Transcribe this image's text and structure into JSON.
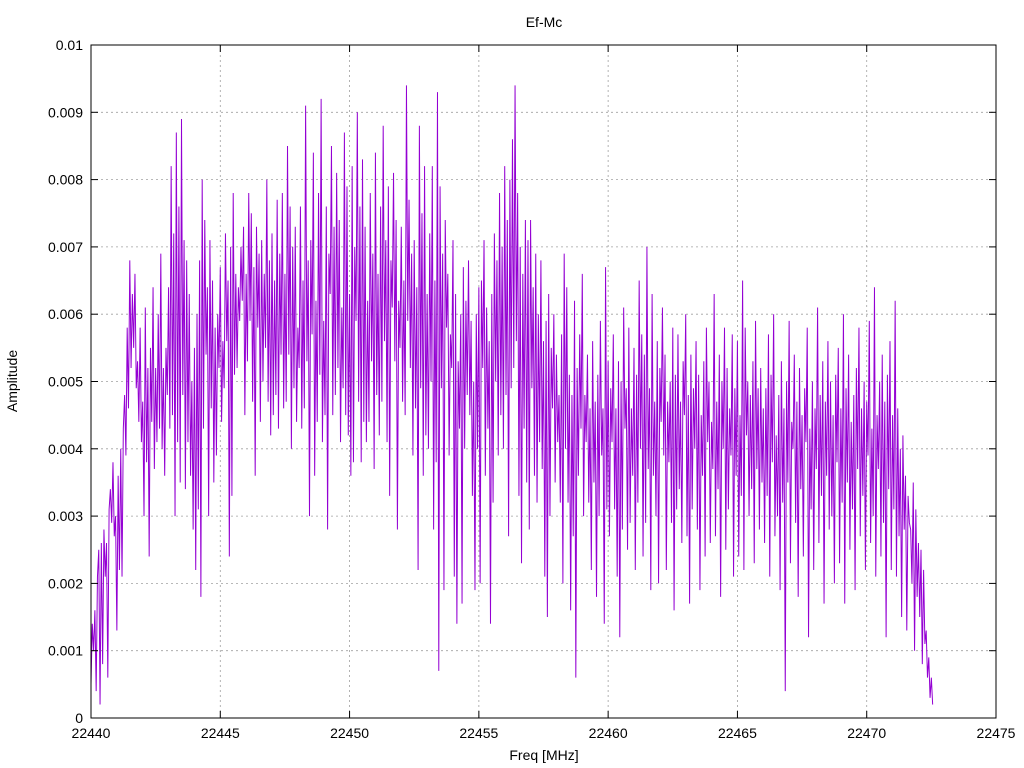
{
  "chart_data": {
    "type": "line",
    "title": "Ef-Mc",
    "xlabel": "Freq [MHz]",
    "ylabel": "Amplitude",
    "xlim": [
      22440,
      22475
    ],
    "ylim": [
      0,
      0.01
    ],
    "x_ticks": [
      "22440",
      "22445",
      "22450",
      "22455",
      "22460",
      "22465",
      "22470",
      "22475"
    ],
    "y_ticks": [
      "0",
      "0.001",
      "0.002",
      "0.003",
      "0.004",
      "0.005",
      "0.006",
      "0.007",
      "0.008",
      "0.009",
      "0.01"
    ],
    "grid": true,
    "legend": "none",
    "series": [
      {
        "color": "#9400d3",
        "x_start": 22440.0,
        "x_step": 0.05,
        "y": [
          0.0005,
          0.0014,
          0.001,
          0.0016,
          0.0004,
          0.0021,
          0.0025,
          0.0002,
          0.0026,
          0.0008,
          0.0028,
          0.0021,
          0.0026,
          0.0006,
          0.0031,
          0.0034,
          0.0029,
          0.0038,
          0.0027,
          0.003,
          0.0013,
          0.0036,
          0.0022,
          0.004,
          0.0021,
          0.0043,
          0.0048,
          0.0039,
          0.0058,
          0.0046,
          0.0068,
          0.0052,
          0.0063,
          0.0055,
          0.0066,
          0.0049,
          0.0053,
          0.0044,
          0.0058,
          0.0041,
          0.0047,
          0.003,
          0.0061,
          0.0038,
          0.0052,
          0.0024,
          0.0055,
          0.0044,
          0.0064,
          0.0037,
          0.0052,
          0.0041,
          0.006,
          0.0043,
          0.0069,
          0.004,
          0.0052,
          0.0036,
          0.0055,
          0.0048,
          0.0064,
          0.0043,
          0.0082,
          0.0045,
          0.0072,
          0.003,
          0.0087,
          0.0041,
          0.0076,
          0.0035,
          0.0089,
          0.0048,
          0.0071,
          0.0034,
          0.0068,
          0.0041,
          0.0063,
          0.0036,
          0.005,
          0.0028,
          0.0055,
          0.0022,
          0.006,
          0.0031,
          0.0068,
          0.0018,
          0.008,
          0.0043,
          0.0074,
          0.0054,
          0.0064,
          0.003,
          0.0071,
          0.0046,
          0.0065,
          0.0035,
          0.0058,
          0.0039,
          0.006,
          0.0052,
          0.0067,
          0.0044,
          0.0056,
          0.0049,
          0.0072,
          0.0056,
          0.0065,
          0.0024,
          0.007,
          0.0033,
          0.0078,
          0.0051,
          0.0066,
          0.0052,
          0.0064,
          0.0059,
          0.007,
          0.0062,
          0.0073,
          0.0045,
          0.0066,
          0.0053,
          0.0078,
          0.0059,
          0.0075,
          0.0047,
          0.0067,
          0.0036,
          0.0073,
          0.0058,
          0.0069,
          0.0044,
          0.0071,
          0.005,
          0.0066,
          0.0055,
          0.008,
          0.0047,
          0.0068,
          0.0042,
          0.0072,
          0.0045,
          0.0065,
          0.0048,
          0.0077,
          0.0043,
          0.0069,
          0.0054,
          0.0078,
          0.0046,
          0.0066,
          0.0047,
          0.0085,
          0.0054,
          0.0076,
          0.004,
          0.007,
          0.0049,
          0.0073,
          0.0044,
          0.0058,
          0.0052,
          0.0076,
          0.0043,
          0.0065,
          0.0046,
          0.0091,
          0.0053,
          0.0068,
          0.003,
          0.0071,
          0.0057,
          0.0084,
          0.0036,
          0.0062,
          0.0044,
          0.0078,
          0.0051,
          0.0092,
          0.0041,
          0.0059,
          0.0045,
          0.0076,
          0.0028,
          0.0069,
          0.0063,
          0.0085,
          0.0045,
          0.0073,
          0.0048,
          0.0081,
          0.0052,
          0.0074,
          0.0041,
          0.0061,
          0.0049,
          0.0087,
          0.0045,
          0.0079,
          0.0042,
          0.0063,
          0.0036,
          0.0082,
          0.0038,
          0.007,
          0.0059,
          0.009,
          0.0047,
          0.0076,
          0.0038,
          0.0083,
          0.0044,
          0.0073,
          0.0041,
          0.0062,
          0.0044,
          0.0078,
          0.0053,
          0.0069,
          0.0037,
          0.0084,
          0.0048,
          0.0066,
          0.0042,
          0.0076,
          0.0047,
          0.0088,
          0.0056,
          0.0071,
          0.0041,
          0.0079,
          0.0033,
          0.0068,
          0.0061,
          0.0081,
          0.0053,
          0.0074,
          0.0028,
          0.0062,
          0.0055,
          0.0073,
          0.0047,
          0.0065,
          0.0045,
          0.0094,
          0.0059,
          0.0077,
          0.0052,
          0.0069,
          0.0039,
          0.0071,
          0.0046,
          0.0064,
          0.0022,
          0.0088,
          0.0049,
          0.0075,
          0.0036,
          0.0082,
          0.0042,
          0.0063,
          0.004,
          0.0072,
          0.005,
          0.0082,
          0.0028,
          0.0065,
          0.0038,
          0.0093,
          0.0007,
          0.0079,
          0.0049,
          0.0069,
          0.0019,
          0.0074,
          0.0058,
          0.0066,
          0.0039,
          0.0057,
          0.0052,
          0.0071,
          0.0021,
          0.0063,
          0.0014,
          0.0053,
          0.0043,
          0.006,
          0.0017,
          0.0067,
          0.004,
          0.0062,
          0.0048,
          0.0068,
          0.0045,
          0.0059,
          0.0033,
          0.005,
          0.0019,
          0.006,
          0.004,
          0.0064,
          0.002,
          0.0065,
          0.0052,
          0.0071,
          0.0036,
          0.0061,
          0.0043,
          0.0056,
          0.0014,
          0.0063,
          0.0032,
          0.0072,
          0.005,
          0.0068,
          0.0039,
          0.0078,
          0.0045,
          0.007,
          0.004,
          0.0082,
          0.0048,
          0.0074,
          0.0027,
          0.008,
          0.0049,
          0.0086,
          0.0052,
          0.0094,
          0.0056,
          0.0078,
          0.0033,
          0.007,
          0.0023,
          0.0066,
          0.0043,
          0.0074,
          0.0035,
          0.0071,
          0.0028,
          0.0074,
          0.0049,
          0.0064,
          0.0036,
          0.0069,
          0.0032,
          0.006,
          0.0041,
          0.0068,
          0.0037,
          0.0056,
          0.0021,
          0.0059,
          0.0015,
          0.0063,
          0.003,
          0.0055,
          0.0046,
          0.006,
          0.0035,
          0.0054,
          0.0041,
          0.0048,
          0.0032,
          0.0057,
          0.002,
          0.0069,
          0.004,
          0.0064,
          0.0032,
          0.0051,
          0.0016,
          0.0048,
          0.0027,
          0.0062,
          0.0006,
          0.0052,
          0.0036,
          0.0057,
          0.0043,
          0.0066,
          0.003,
          0.0048,
          0.0041,
          0.0054,
          0.0032,
          0.0046,
          0.0022,
          0.0056,
          0.0035,
          0.0047,
          0.0018,
          0.0051,
          0.003,
          0.0059,
          0.0039,
          0.0046,
          0.0014,
          0.0067,
          0.0031,
          0.0053,
          0.0027,
          0.0049,
          0.0041,
          0.0057,
          0.0031,
          0.0046,
          0.0021,
          0.0053,
          0.0012,
          0.005,
          0.0028,
          0.0061,
          0.0043,
          0.0049,
          0.0025,
          0.0058,
          0.0029,
          0.0046,
          0.0036,
          0.0055,
          0.0022,
          0.0051,
          0.0032,
          0.0065,
          0.004,
          0.0057,
          0.0024,
          0.0054,
          0.0029,
          0.007,
          0.0037,
          0.0049,
          0.0019,
          0.0063,
          0.0036,
          0.0047,
          0.003,
          0.0056,
          0.002,
          0.0052,
          0.0044,
          0.0061,
          0.0039,
          0.0054,
          0.0022,
          0.0047,
          0.0038,
          0.005,
          0.0029,
          0.0058,
          0.0016,
          0.0051,
          0.0031,
          0.0057,
          0.0034,
          0.0047,
          0.0026,
          0.0053,
          0.0045,
          0.006,
          0.0027,
          0.0048,
          0.0017,
          0.0054,
          0.0031,
          0.0049,
          0.004,
          0.0056,
          0.0028,
          0.0051,
          0.0019,
          0.0045,
          0.0036,
          0.0053,
          0.0024,
          0.0058,
          0.0041,
          0.005,
          0.0026,
          0.0044,
          0.0037,
          0.0063,
          0.0027,
          0.0047,
          0.0034,
          0.0054,
          0.0018,
          0.005,
          0.004,
          0.0058,
          0.0025,
          0.0052,
          0.0031,
          0.0046,
          0.0039,
          0.0057,
          0.0021,
          0.0049,
          0.0036,
          0.0056,
          0.0024,
          0.0045,
          0.0033,
          0.0065,
          0.0022,
          0.0058,
          0.0042,
          0.005,
          0.003,
          0.0048,
          0.0034,
          0.0053,
          0.0023,
          0.0059,
          0.0037,
          0.0049,
          0.0028,
          0.0052,
          0.0035,
          0.0046,
          0.0026,
          0.0049,
          0.0033,
          0.0057,
          0.0021,
          0.0051,
          0.0038,
          0.006,
          0.0027,
          0.0042,
          0.003,
          0.0048,
          0.0019,
          0.0053,
          0.0032,
          0.0046,
          0.0004,
          0.005,
          0.0035,
          0.0059,
          0.0023,
          0.0044,
          0.004,
          0.0054,
          0.0029,
          0.0047,
          0.0018,
          0.0052,
          0.0034,
          0.0045,
          0.0024,
          0.0049,
          0.0041,
          0.0058,
          0.0012,
          0.0043,
          0.0031,
          0.005,
          0.0022,
          0.0046,
          0.0037,
          0.0061,
          0.0026,
          0.0048,
          0.0033,
          0.0053,
          0.0017,
          0.0047,
          0.0036,
          0.0056,
          0.0028,
          0.005,
          0.003,
          0.0045,
          0.002,
          0.0051,
          0.0038,
          0.0055,
          0.0023,
          0.0046,
          0.0032,
          0.006,
          0.0017,
          0.0049,
          0.0035,
          0.0054,
          0.0025,
          0.0044,
          0.0031,
          0.0048,
          0.0019,
          0.0052,
          0.0037,
          0.0058,
          0.0027,
          0.0046,
          0.0033,
          0.005,
          0.0022,
          0.0047,
          0.0039,
          0.0059,
          0.0026,
          0.0043,
          0.003,
          0.0064,
          0.0021,
          0.0045,
          0.0037,
          0.005,
          0.0024,
          0.0054,
          0.0029,
          0.0047,
          0.0012,
          0.0051,
          0.0034,
          0.0056,
          0.0022,
          0.0045,
          0.0031,
          0.0062,
          0.0021,
          0.0046,
          0.0027,
          0.004,
          0.0015,
          0.0042,
          0.0028,
          0.0036,
          0.0013,
          0.0033,
          0.0029,
          0.0028,
          0.002,
          0.0035,
          0.001,
          0.0031,
          0.0018,
          0.0026,
          0.0015,
          0.0025,
          0.0008,
          0.0022,
          0.0011,
          0.0013,
          0.0006,
          0.0009,
          0.0003,
          0.0006,
          0.0002
        ]
      }
    ]
  }
}
